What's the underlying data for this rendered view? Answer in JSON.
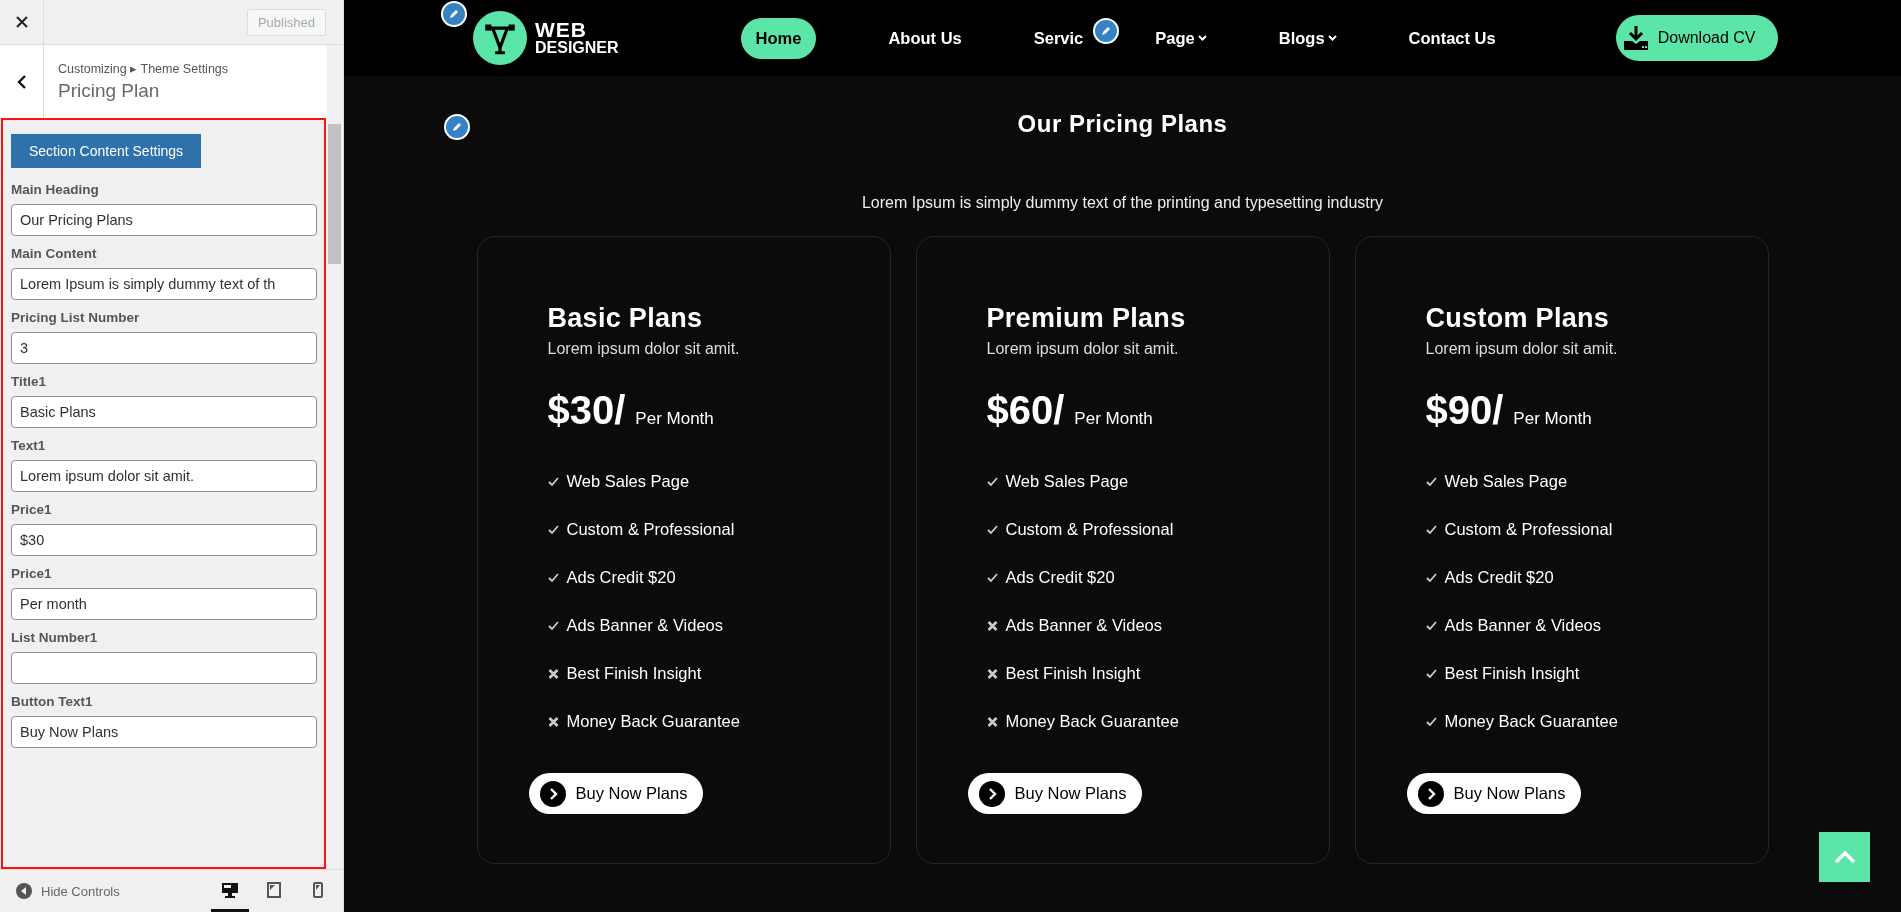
{
  "customizer": {
    "publish_button": "Published",
    "breadcrumb": "Customizing ▸ Theme Settings",
    "panel_title": "Pricing Plan",
    "section_button": "Section Content Settings",
    "fields": [
      {
        "label": "Main Heading",
        "value": "Our Pricing Plans"
      },
      {
        "label": "Main Content",
        "value": "Lorem Ipsum is simply dummy text of th"
      },
      {
        "label": "Pricing List Number",
        "value": "3"
      },
      {
        "label": "Title1",
        "value": "Basic Plans"
      },
      {
        "label": "Text1",
        "value": "Lorem ipsum dolor sit amit."
      },
      {
        "label": "Price1",
        "value": "$30"
      },
      {
        "label": "Price1",
        "value": "Per month"
      },
      {
        "label": "List Number1"
      },
      {
        "label": "Button Text1",
        "value": "Buy Now Plans"
      }
    ],
    "hide_controls": "Hide Controls",
    "devices": [
      {
        "kind": "desktop",
        "selected": true
      },
      {
        "kind": "tablet",
        "selected": false
      },
      {
        "kind": "mobile",
        "selected": false
      }
    ]
  },
  "site": {
    "logo": {
      "line1": "WEB",
      "line2": "DESIGNER"
    },
    "nav": [
      {
        "label": "Home",
        "selected": true,
        "dropdown": false
      },
      {
        "label": "About Us",
        "selected": false,
        "dropdown": false
      },
      {
        "label": "Servic",
        "selected": false,
        "dropdown": false
      },
      {
        "label": "Page",
        "selected": false,
        "dropdown": true
      },
      {
        "label": "Blogs",
        "selected": false,
        "dropdown": true
      },
      {
        "label": "Contact Us",
        "selected": false,
        "dropdown": false
      }
    ],
    "download_button": "Download CV",
    "heading": "Our Pricing Plans",
    "intro": "Lorem Ipsum is simply dummy text of the printing and typesetting industry",
    "plans": [
      {
        "title": "Basic Plans",
        "text": "Lorem ipsum dolor sit amit.",
        "price": "$30/",
        "period": "Per Month",
        "button": "Buy Now Plans",
        "features": [
          {
            "label": "Web Sales Page",
            "included": true
          },
          {
            "label": "Custom & Professional",
            "included": true
          },
          {
            "label": "Ads Credit $20",
            "included": true
          },
          {
            "label": "Ads Banner & Videos",
            "included": true
          },
          {
            "label": "Best Finish Insight",
            "included": false
          },
          {
            "label": "Money Back Guarantee",
            "included": false
          }
        ]
      },
      {
        "title": "Premium Plans",
        "text": "Lorem ipsum dolor sit amit.",
        "price": "$60/",
        "period": "Per Month",
        "button": "Buy Now Plans",
        "features": [
          {
            "label": "Web Sales Page",
            "included": true
          },
          {
            "label": "Custom & Professional",
            "included": true
          },
          {
            "label": "Ads Credit $20",
            "included": true
          },
          {
            "label": "Ads Banner & Videos",
            "included": false
          },
          {
            "label": "Best Finish Insight",
            "included": false
          },
          {
            "label": "Money Back Guarantee",
            "included": false
          }
        ]
      },
      {
        "title": "Custom Plans",
        "text": "Lorem ipsum dolor sit amit.",
        "price": "$90/",
        "period": "Per Month",
        "button": "Buy Now Plans",
        "features": [
          {
            "label": "Web Sales Page",
            "included": true
          },
          {
            "label": "Custom & Professional",
            "included": true
          },
          {
            "label": "Ads Credit $20",
            "included": true
          },
          {
            "label": "Ads Banner & Videos",
            "included": true
          },
          {
            "label": "Best Finish Insight",
            "included": true
          },
          {
            "label": "Money Back Guarantee",
            "included": true
          }
        ]
      }
    ]
  }
}
